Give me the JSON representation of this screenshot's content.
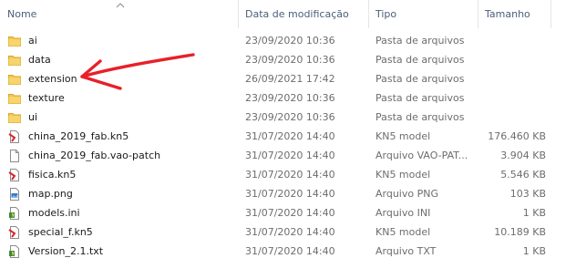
{
  "columns": {
    "name": "Nome",
    "date": "Data de modificação",
    "type": "Tipo",
    "size": "Tamanho"
  },
  "colors": {
    "folder": "#f4c84e",
    "annotation_arrow": "#e8202a",
    "header_text": "#4c607a",
    "secondary_text": "#6d6d6d"
  },
  "files": [
    {
      "name": "ai",
      "date": "23/09/2020 10:36",
      "type": "Pasta de arquivos",
      "size": "",
      "icon": "folder-icon"
    },
    {
      "name": "data",
      "date": "23/09/2020 10:36",
      "type": "Pasta de arquivos",
      "size": "",
      "icon": "folder-icon"
    },
    {
      "name": "extension",
      "date": "26/09/2021 17:42",
      "type": "Pasta de arquivos",
      "size": "",
      "icon": "folder-icon"
    },
    {
      "name": "texture",
      "date": "23/09/2020 10:36",
      "type": "Pasta de arquivos",
      "size": "",
      "icon": "folder-icon"
    },
    {
      "name": "ui",
      "date": "23/09/2020 10:36",
      "type": "Pasta de arquivos",
      "size": "",
      "icon": "folder-icon"
    },
    {
      "name": "china_2019_fab.kn5",
      "date": "31/07/2020 14:40",
      "type": "KN5 model",
      "size": "176.460 KB",
      "icon": "kn5-file-icon"
    },
    {
      "name": "china_2019_fab.vao-patch",
      "date": "31/07/2020 14:40",
      "type": "Arquivo VAO-PAT...",
      "size": "3.904 KB",
      "icon": "blank-file-icon"
    },
    {
      "name": "fisica.kn5",
      "date": "31/07/2020 14:40",
      "type": "KN5 model",
      "size": "5.546 KB",
      "icon": "kn5-file-icon"
    },
    {
      "name": "map.png",
      "date": "31/07/2020 14:40",
      "type": "Arquivo PNG",
      "size": "103 KB",
      "icon": "image-file-icon"
    },
    {
      "name": "models.ini",
      "date": "31/07/2020 14:40",
      "type": "Arquivo INI",
      "size": "1 KB",
      "icon": "ini-file-icon"
    },
    {
      "name": "special_f.kn5",
      "date": "31/07/2020 14:40",
      "type": "KN5 model",
      "size": "10.189 KB",
      "icon": "kn5-file-icon"
    },
    {
      "name": "Version_2.1.txt",
      "date": "31/07/2020 14:40",
      "type": "Arquivo TXT",
      "size": "1 KB",
      "icon": "txt-file-icon"
    }
  ]
}
